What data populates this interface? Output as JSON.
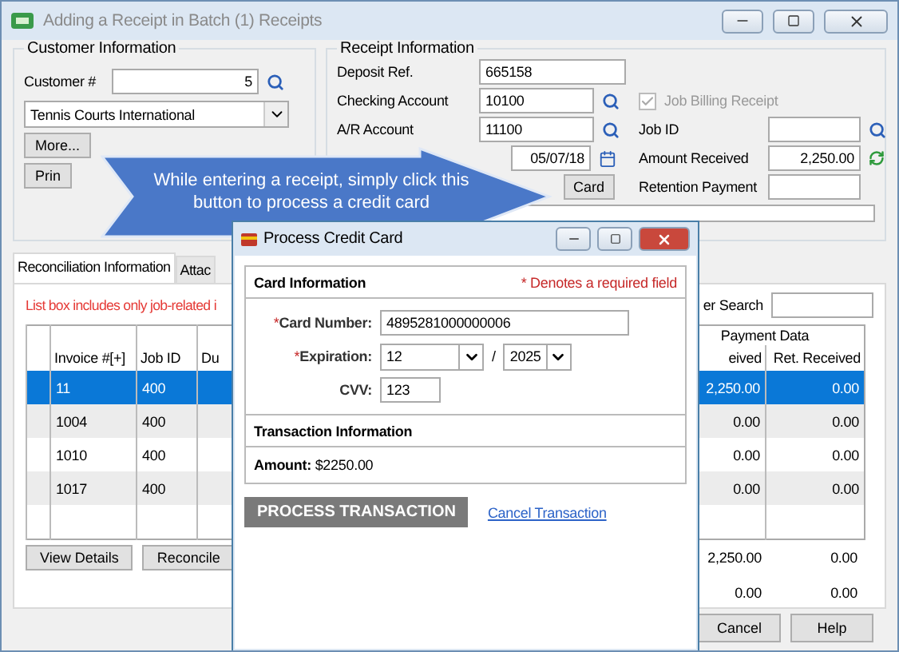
{
  "window": {
    "title": "Adding a Receipt in Batch (1) Receipts"
  },
  "customer_info": {
    "title": "Customer Information",
    "customer_label": "Customer #",
    "customer_value": "5",
    "customer_name": "Tennis Courts International",
    "buttons": [
      "More...",
      "Prin"
    ]
  },
  "receipt_info": {
    "title": "Receipt Information",
    "left_fields": [
      {
        "kind": "text",
        "label": "Deposit Ref.",
        "value": "665158",
        "lookup": false
      },
      {
        "kind": "text",
        "label": "Checking Account",
        "value": "10100",
        "lookup": true
      },
      {
        "kind": "text",
        "label": "A/R Account",
        "value": "11100",
        "lookup": true
      },
      {
        "kind": "date",
        "value": "05/07/18"
      },
      {
        "kind": "button",
        "value": "Card"
      }
    ],
    "job_billing": {
      "label": "Job Billing Receipt",
      "checked": true,
      "disabled": true
    },
    "right_fields": [
      {
        "kind": "lookup",
        "label": "Job ID"
      },
      {
        "kind": "refresh",
        "label": "Amount Received",
        "value": "2,250.00"
      },
      {
        "kind": "plain",
        "label": "Retention Payment"
      }
    ]
  },
  "tabs": [
    {
      "label": "Reconciliation Information",
      "selected": true
    },
    {
      "label": "Attac",
      "selected": false
    }
  ],
  "notice": "List box includes only job-related i",
  "search_label": "er Search",
  "grid": {
    "group_header": "Payment Data",
    "columns": [
      "Invoice #[+]",
      "Job ID",
      "Du",
      "eived",
      "Ret. Received"
    ],
    "rows": [
      {
        "invoice": "11",
        "job_id": "400",
        "received": "2,250.00",
        "ret_received": "0.00",
        "selected": true
      },
      {
        "invoice": "1004",
        "job_id": "400",
        "received": "0.00",
        "ret_received": "0.00",
        "selected": false
      },
      {
        "invoice": "1010",
        "job_id": "400",
        "received": "0.00",
        "ret_received": "0.00",
        "selected": false
      },
      {
        "invoice": "1017",
        "job_id": "400",
        "received": "0.00",
        "ret_received": "0.00",
        "selected": false
      }
    ]
  },
  "grid_buttons": [
    "View Details",
    "Reconcile"
  ],
  "totals": [
    [
      "2,250.00",
      "0.00"
    ],
    [
      "0.00",
      "0.00"
    ]
  ],
  "footer_buttons": [
    "Cancel",
    "Help"
  ],
  "callout": {
    "text": "While entering a receipt, simply click this button to process a credit card"
  },
  "dialog": {
    "title": "Process Credit Card",
    "required_mark": "*",
    "card_section": {
      "title": "Card Information",
      "required_note": "* Denotes a required field"
    },
    "card_number": {
      "label": "Card Number:",
      "required": true,
      "value": "4895281000000006"
    },
    "expiration": {
      "label": "Expiration:",
      "required": true,
      "month": "12",
      "separator": "/",
      "year": "2025"
    },
    "cvv": {
      "label": "CVV:",
      "required": false,
      "value": "123"
    },
    "transaction_section": {
      "title": "Transaction Information",
      "amount_label": "Amount:",
      "amount": "$2250.00"
    },
    "process_button": "PROCESS TRANSACTION",
    "cancel_link": "Cancel Transaction"
  }
}
